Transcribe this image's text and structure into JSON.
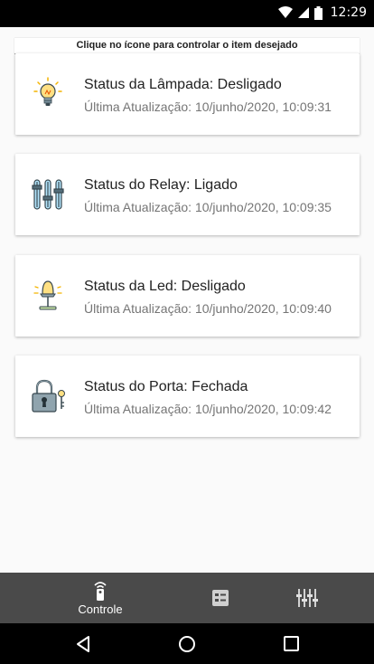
{
  "status_bar": {
    "time": "12:29"
  },
  "hint": "Clique no ícone para controlar o item desejado",
  "cards": [
    {
      "title": "Status da Lâmpada: Desligado",
      "updated": "Última Atualização: 10/junho/2020, 10:09:31",
      "icon": "lightbulb-icon"
    },
    {
      "title": "Status do Relay: Ligado",
      "updated": "Última Atualização: 10/junho/2020, 10:09:35",
      "icon": "sliders-icon"
    },
    {
      "title": "Status da Led: Desligado",
      "updated": "Última Atualização: 10/junho/2020, 10:09:40",
      "icon": "lamp-icon"
    },
    {
      "title": "Status do Porta: Fechada",
      "updated": "Última Atualização: 10/junho/2020, 10:09:42",
      "icon": "padlock-key-icon"
    }
  ],
  "bottom_nav": {
    "controle_label": "Controle",
    "items": [
      "remote-control-icon",
      "list-icon",
      "equalizer-icon"
    ]
  },
  "colors": {
    "bottom_nav_bg": "#4a4a4a",
    "status_bar_bg": "#000000",
    "page_bg": "#fafafa"
  }
}
